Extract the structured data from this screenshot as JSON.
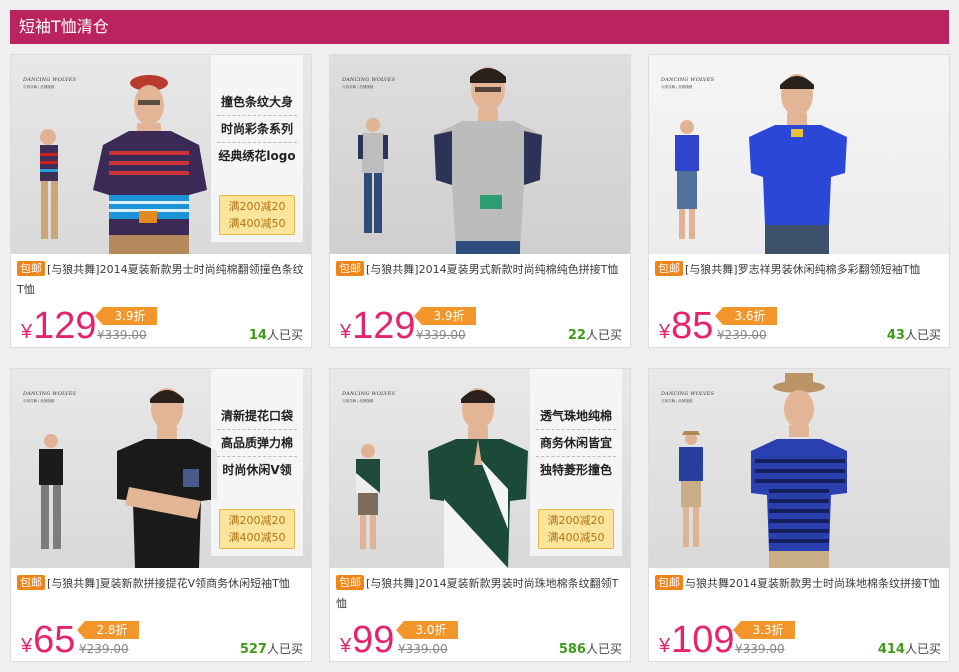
{
  "header": {
    "title": "短袖T恤清仓"
  },
  "brand": {
    "name": "DANCING WOLVES",
    "sub": "与狼共舞 | 品牌旗舰"
  },
  "products": [
    {
      "title": "[与狼共舞]2014夏装新款男士时尚纯棉翻领撞色条纹T恤",
      "tag": "包邮",
      "price": "129",
      "original_price": "¥339.00",
      "discount": "3.9折",
      "sold_count": "14",
      "sold_label": "人已买",
      "features": [
        "撞色条纹大身",
        "时尚彩条系列",
        "经典绣花logo"
      ],
      "promo": [
        "满200减20",
        "满400减50"
      ]
    },
    {
      "title": "[与狼共舞]2014夏装男式新款时尚纯棉纯色拼接T恤",
      "tag": "包邮",
      "price": "129",
      "original_price": "¥339.00",
      "discount": "3.9折",
      "sold_count": "22",
      "sold_label": "人已买"
    },
    {
      "title": "[与狼共舞]罗志祥男装休闲纯棉多彩翻领短袖T恤",
      "tag": "包邮",
      "price": "85",
      "original_price": "¥239.00",
      "discount": "3.6折",
      "sold_count": "43",
      "sold_label": "人已买"
    },
    {
      "title": "[与狼共舞]夏装新款拼接提花V领商务休闲短袖T恤",
      "tag": "包邮",
      "price": "65",
      "original_price": "¥239.00",
      "discount": "2.8折",
      "sold_count": "527",
      "sold_label": "人已买",
      "features": [
        "清新提花口袋",
        "高品质弹力棉",
        "时尚休闲V领"
      ],
      "promo": [
        "满200减20",
        "满400减50"
      ]
    },
    {
      "title": "[与狼共舞]2014夏装新款男装时尚珠地棉条纹翻领T恤",
      "tag": "包邮",
      "price": "99",
      "original_price": "¥339.00",
      "discount": "3.0折",
      "sold_count": "586",
      "sold_label": "人已买",
      "features": [
        "透气珠地纯棉",
        "商务休闲皆宜",
        "独特菱形撞色"
      ],
      "promo": [
        "满200减20",
        "满400减50"
      ]
    },
    {
      "title": "与狼共舞2014夏装新款男士时尚珠地棉条纹拼接T恤",
      "tag": "包邮",
      "price": "109",
      "original_price": "¥339.00",
      "discount": "3.3折",
      "sold_count": "414",
      "sold_label": "人已买"
    }
  ]
}
